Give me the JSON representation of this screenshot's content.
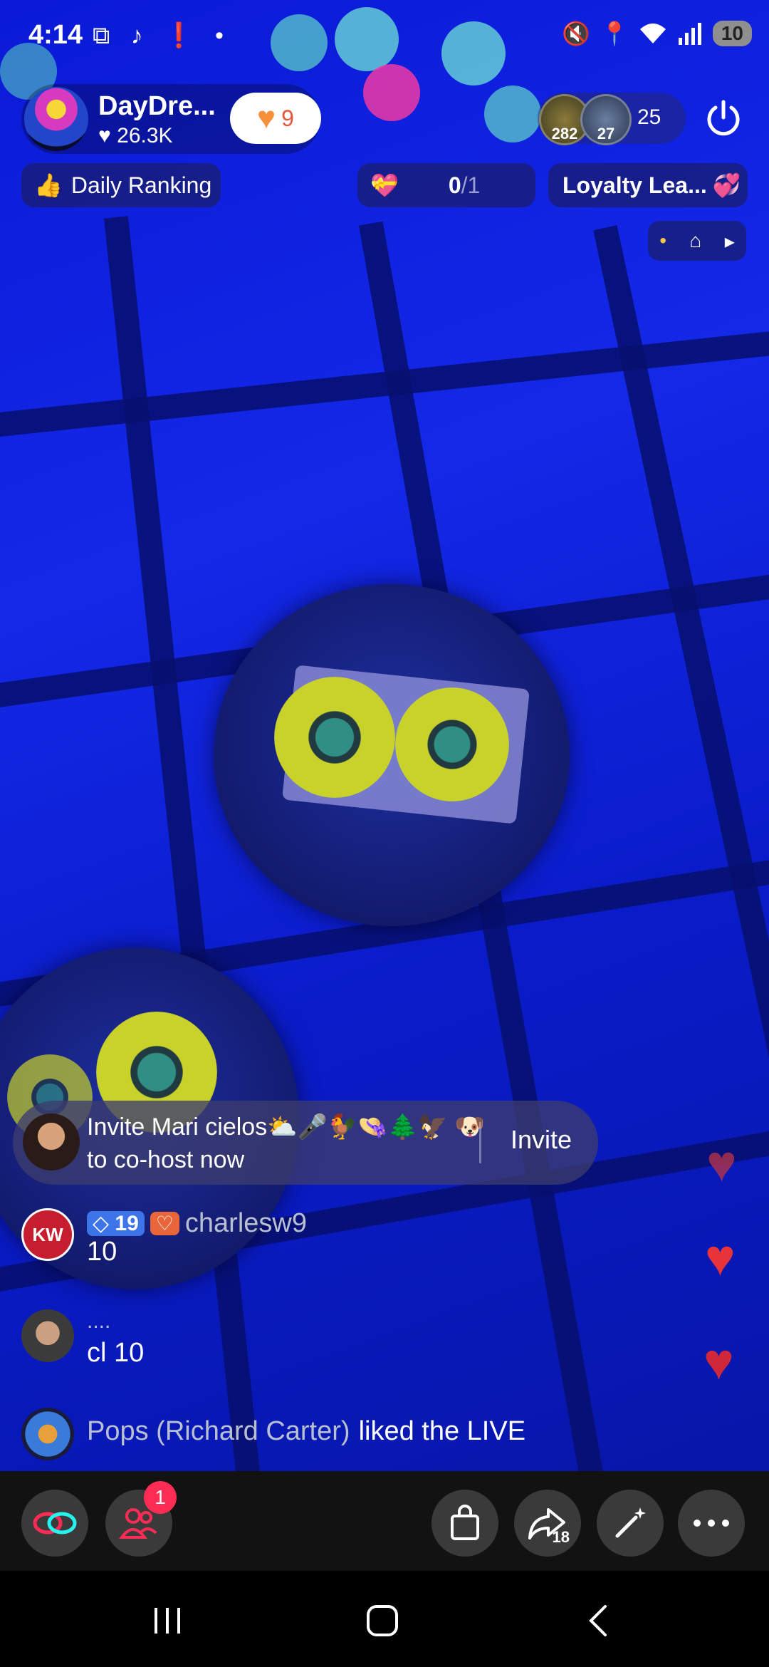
{
  "status_bar": {
    "time": "4:14",
    "left_icons": "screenshot tiktok alert dot",
    "battery": "10"
  },
  "host": {
    "name": "DayDre...",
    "likes": "♥ 26.3K",
    "follow_count": "9"
  },
  "viewers": {
    "avatar1_count": "282",
    "avatar2_count": "27",
    "total": "25"
  },
  "pills": {
    "daily_ranking": "Daily Ranking",
    "goal_current": "0",
    "goal_total": "/1",
    "loyalty": "Loyalty Lea..."
  },
  "invite": {
    "text": "Invite Mari cielos⛅🎤🐓👒🌲🦅 🐶 to co-host now",
    "button": "Invite"
  },
  "chat": [
    {
      "level": "19",
      "username": "charlesw9",
      "message": "10",
      "avatar_text": "KW"
    },
    {
      "username": "....",
      "message": "cl 10"
    },
    {
      "username": "Pops (Richard Carter)",
      "message": "liked the LIVE"
    }
  ],
  "toolbar": {
    "badge": "1",
    "share_count": "18"
  },
  "colors": {
    "accent": "#fe2c55",
    "heart": "#e8333b",
    "stage": "#1428e8"
  }
}
